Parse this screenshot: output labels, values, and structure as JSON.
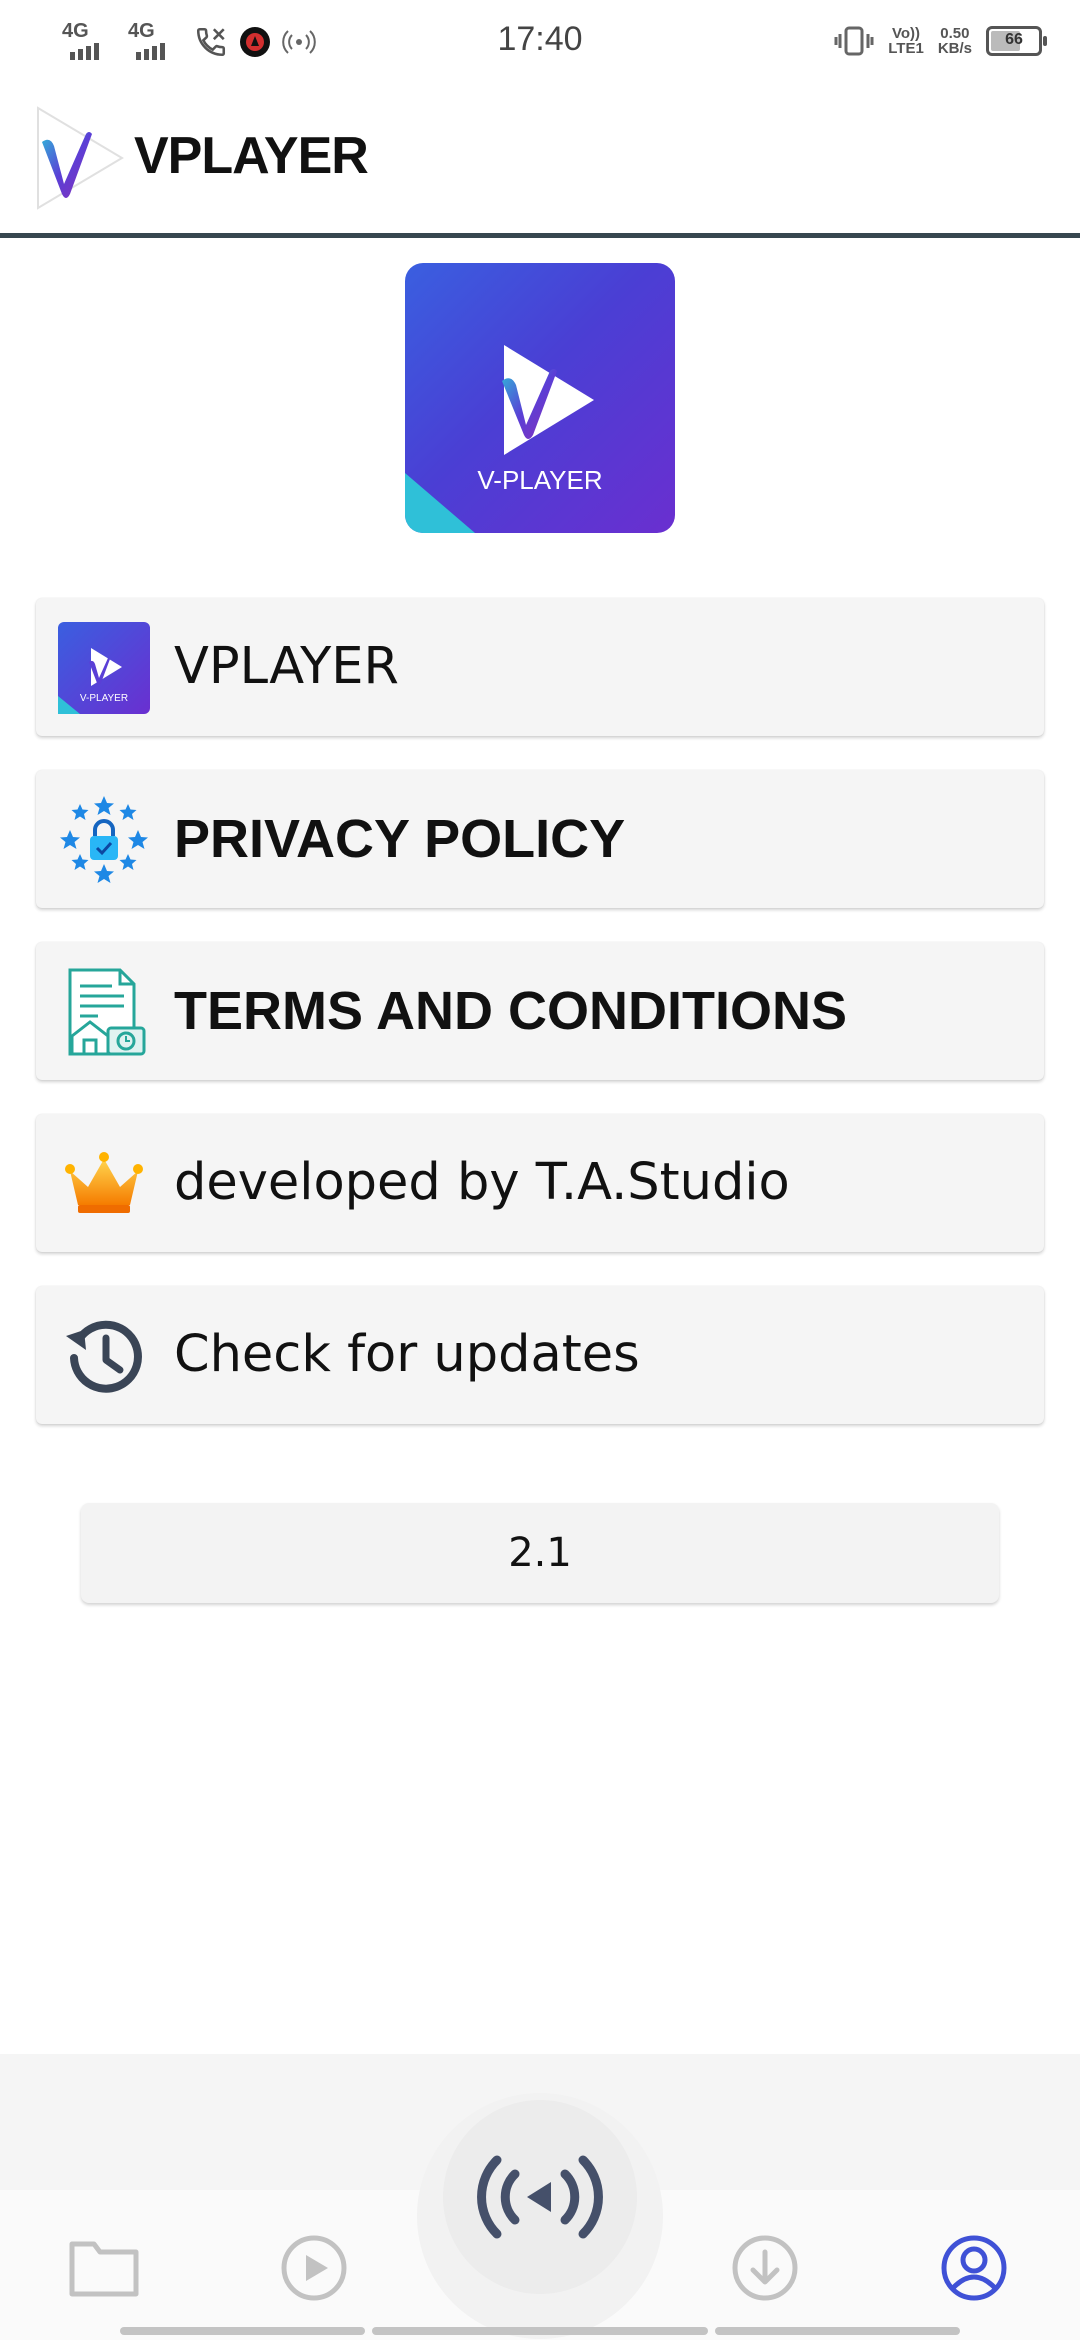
{
  "status_bar": {
    "sim1": "4G",
    "sim2": "4G",
    "time": "17:40",
    "volte": "Vo))",
    "lte": "LTE1",
    "speed_value": "0.50",
    "speed_unit": "KB/s",
    "battery": "66",
    "battery_level_percent": 66
  },
  "app_bar": {
    "title": "VPLAYER"
  },
  "logo": {
    "caption": "V-PLAYER"
  },
  "menu": {
    "items": [
      {
        "label": "VPLAYER",
        "icon": "app-icon"
      },
      {
        "label": "PRIVACY POLICY",
        "icon": "privacy-lock-icon"
      },
      {
        "label": "TERMS AND CONDITIONS",
        "icon": "terms-document-icon"
      },
      {
        "label": "developed by T.A.Studio",
        "icon": "crown-icon"
      },
      {
        "label": "Check for updates",
        "icon": "history-icon"
      }
    ]
  },
  "version": "2.1",
  "bottom_nav": {
    "items": [
      "folder-icon",
      "play-icon",
      "broadcast-icon",
      "download-icon",
      "profile-icon"
    ],
    "active": "profile-icon"
  },
  "colors": {
    "accent": "#3f51d6",
    "app_bar_border": "#37474f",
    "card_bg": "#f5f5f5",
    "logo_gradient_start": "#3a5fe0",
    "logo_gradient_end": "#6a2fd0"
  }
}
